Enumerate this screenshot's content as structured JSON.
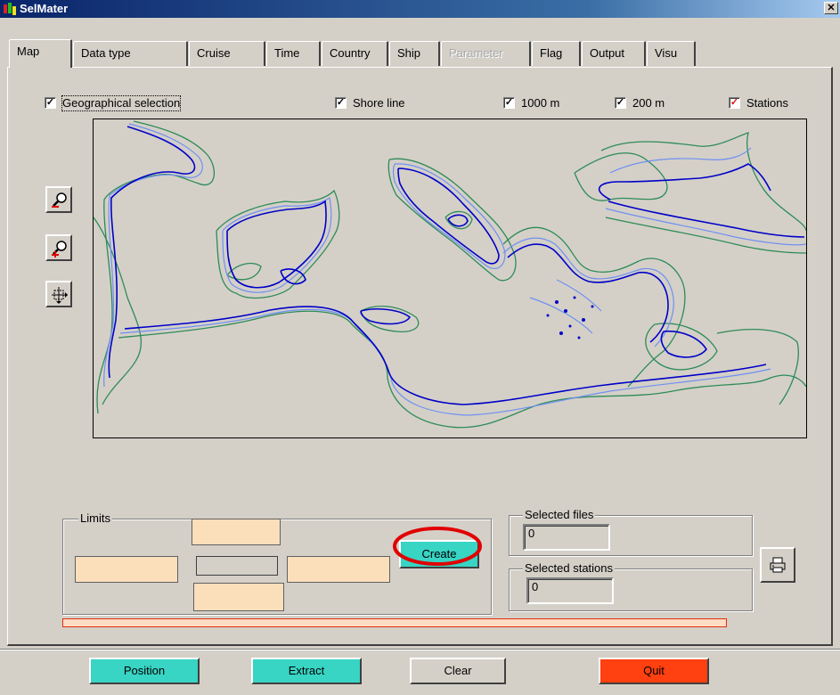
{
  "window": {
    "title": "SelMater",
    "close_label": "✕"
  },
  "tabs": [
    {
      "label": "Map",
      "active": true
    },
    {
      "label": "Data type"
    },
    {
      "label": "Cruise"
    },
    {
      "label": "Time"
    },
    {
      "label": "Country"
    },
    {
      "label": "Ship"
    },
    {
      "label": "Parameter",
      "disabled": true
    },
    {
      "label": "Flag"
    },
    {
      "label": "Output"
    },
    {
      "label": "Visu"
    }
  ],
  "checkboxes": {
    "geo": {
      "label": "Geographical selection",
      "checked": true
    },
    "shore": {
      "label": "Shore line",
      "checked": true
    },
    "m1000": {
      "label": "1000 m",
      "checked": true
    },
    "m200": {
      "label": "200 m",
      "checked": true
    },
    "stations": {
      "label": "Stations",
      "checked": true,
      "mark_color": "#e01010"
    }
  },
  "map": {
    "colors": {
      "shore": "#0000c8",
      "isobath_200": "#7090f0",
      "isobath_1000": "#2e8b57"
    },
    "tools": [
      "zoom-out-icon",
      "zoom-in-icon",
      "pan-icon"
    ]
  },
  "limits": {
    "title": "Limits",
    "north": "",
    "south": "",
    "west": "",
    "east": "",
    "create_label": "Create"
  },
  "selected_files": {
    "title": "Selected files",
    "value": "0"
  },
  "selected_stations": {
    "title": "Selected stations",
    "value": "0"
  },
  "print_icon": "printer-icon",
  "buttons": {
    "position": {
      "label": "Position",
      "color": "#38d4c4"
    },
    "extract": {
      "label": "Extract",
      "color": "#38d4c4"
    },
    "clear": {
      "label": "Clear",
      "color": "#d4d0c8"
    },
    "quit": {
      "label": "Quit",
      "color": "#ff4010"
    }
  },
  "annotation_color": "#e00000"
}
